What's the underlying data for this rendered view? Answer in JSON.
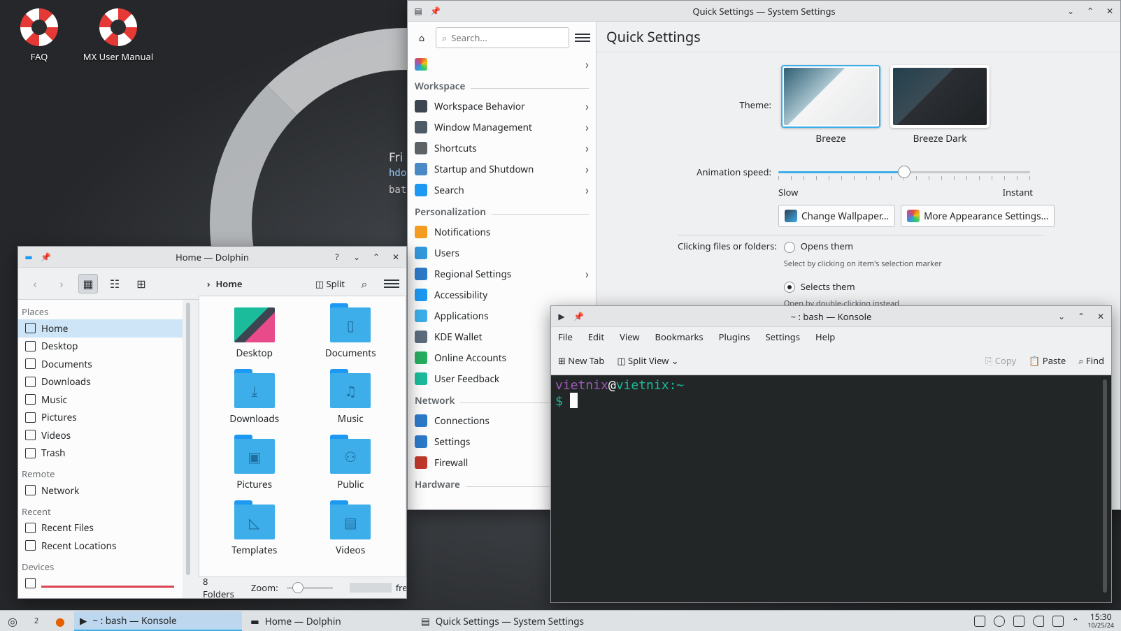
{
  "desktop": {
    "icons": [
      {
        "label": "FAQ"
      },
      {
        "label": "MX User Manual"
      }
    ],
    "snippet": [
      "Fri",
      "hdo",
      "bat"
    ]
  },
  "settings": {
    "title": "Quick Settings — System Settings",
    "search_placeholder": "Search...",
    "page_title": "Quick Settings",
    "sections": [
      {
        "heading": "",
        "items": [
          {
            "label": "",
            "icon": "quick-settings",
            "color": "#e74c3c",
            "chevron": true
          }
        ]
      },
      {
        "heading": "Workspace",
        "items": [
          {
            "label": "Workspace Behavior",
            "chevron": true,
            "color": "#3d4551"
          },
          {
            "label": "Window Management",
            "chevron": true,
            "color": "#4e5a66"
          },
          {
            "label": "Shortcuts",
            "chevron": true,
            "color": "#5d6266"
          },
          {
            "label": "Startup and Shutdown",
            "chevron": true,
            "color": "#4b88c6"
          },
          {
            "label": "Search",
            "chevron": true,
            "color": "#1d99f3"
          }
        ]
      },
      {
        "heading": "Personalization",
        "items": [
          {
            "label": "Notifications",
            "chevron": false,
            "color": "#f39c1f"
          },
          {
            "label": "Users",
            "chevron": false,
            "color": "#3498db"
          },
          {
            "label": "Regional Settings",
            "chevron": true,
            "color": "#2c7ac9"
          },
          {
            "label": "Accessibility",
            "chevron": false,
            "color": "#1d99f3"
          },
          {
            "label": "Applications",
            "chevron": false,
            "color": "#3daee9"
          },
          {
            "label": "KDE Wallet",
            "chevron": false,
            "color": "#5d6d7e"
          },
          {
            "label": "Online Accounts",
            "chevron": false,
            "color": "#27ae60"
          },
          {
            "label": "User Feedback",
            "chevron": false,
            "color": "#1abc9c"
          }
        ]
      },
      {
        "heading": "Network",
        "items": [
          {
            "label": "Connections",
            "chevron": false,
            "color": "#2c7ac9"
          },
          {
            "label": "Settings",
            "chevron": false,
            "color": "#2c7ac9"
          },
          {
            "label": "Firewall",
            "chevron": false,
            "color": "#c0392b"
          }
        ]
      },
      {
        "heading": "Hardware",
        "items": []
      }
    ],
    "theme_label": "Theme:",
    "themes": [
      {
        "name": "Breeze",
        "selected": true
      },
      {
        "name": "Breeze Dark",
        "selected": false
      }
    ],
    "animation_label": "Animation speed:",
    "animation_value": 0.5,
    "slow_label": "Slow",
    "instant_label": "Instant",
    "change_wallpaper": "Change Wallpaper...",
    "more_appearance": "More Appearance Settings...",
    "clicking_label": "Clicking files or folders:",
    "opens_them": "Opens them",
    "opens_hint": "Select by clicking on item's selection marker",
    "selects_them": "Selects them",
    "selects_hint": "Open by double-clicking instead"
  },
  "dolphin": {
    "title": "Home — Dolphin",
    "breadcrumb": "Home",
    "split_label": "Split",
    "places_heading": "Places",
    "places": [
      "Home",
      "Desktop",
      "Documents",
      "Downloads",
      "Music",
      "Pictures",
      "Videos",
      "Trash"
    ],
    "remote_heading": "Remote",
    "remote": [
      "Network"
    ],
    "recent_heading": "Recent",
    "recent": [
      "Recent Files",
      "Recent Locations"
    ],
    "devices_heading": "Devices",
    "folders": [
      {
        "name": "Desktop",
        "glyph": "desktop"
      },
      {
        "name": "Documents",
        "glyph": "doc"
      },
      {
        "name": "Downloads",
        "glyph": "down"
      },
      {
        "name": "Music",
        "glyph": "music"
      },
      {
        "name": "Pictures",
        "glyph": "pic"
      },
      {
        "name": "Public",
        "glyph": "public"
      },
      {
        "name": "Templates",
        "glyph": "tmpl"
      },
      {
        "name": "Videos",
        "glyph": "video"
      }
    ],
    "status": "8 Folders",
    "zoom_label": "Zoom:",
    "free_label": "free"
  },
  "konsole": {
    "title": "~ : bash — Konsole",
    "menu": [
      "File",
      "Edit",
      "View",
      "Bookmarks",
      "Plugins",
      "Settings",
      "Help"
    ],
    "new_tab": "New Tab",
    "split_view": "Split View",
    "copy": "Copy",
    "paste": "Paste",
    "find": "Find",
    "prompt_user": "vietnix",
    "prompt_at": "@",
    "prompt_host": "vietnix",
    "prompt_path": ":~",
    "prompt_symbol": "$"
  },
  "taskbar": {
    "tasks": [
      {
        "label": "~ : bash — Konsole",
        "active": true
      },
      {
        "label": "Home — Dolphin",
        "active": false
      },
      {
        "label": "Quick Settings — System Settings",
        "active": false
      }
    ],
    "pager_label": "2",
    "time": "15:30",
    "date": "10/25/24"
  }
}
